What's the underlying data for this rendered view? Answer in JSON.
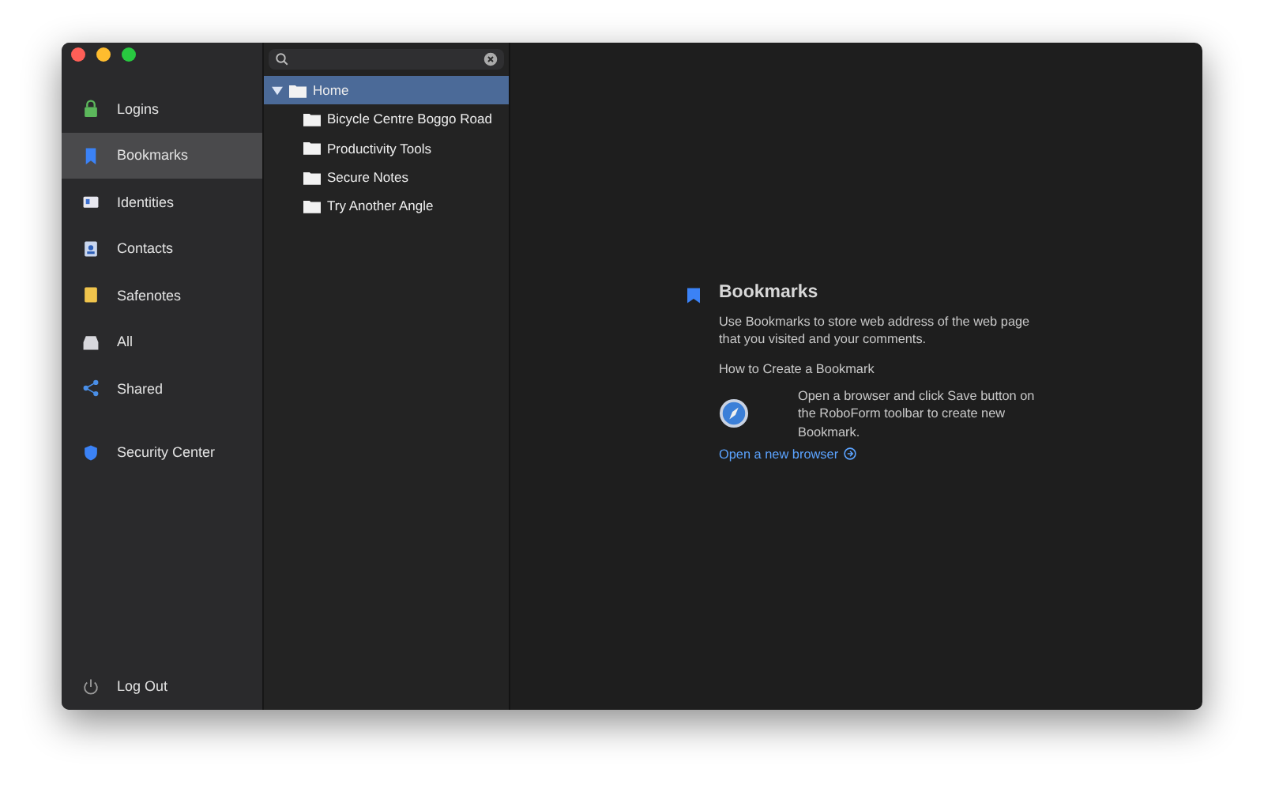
{
  "sidebar": {
    "items": [
      {
        "label": "Logins",
        "kind": "lock",
        "selected": false
      },
      {
        "label": "Bookmarks",
        "kind": "bookmark",
        "selected": true
      },
      {
        "label": "Identities",
        "kind": "id",
        "selected": false
      },
      {
        "label": "Contacts",
        "kind": "contact",
        "selected": false
      },
      {
        "label": "Safenotes",
        "kind": "note",
        "selected": false
      },
      {
        "label": "All",
        "kind": "tray",
        "selected": false
      },
      {
        "label": "Shared",
        "kind": "share",
        "selected": false
      }
    ],
    "secondary_items": [
      {
        "label": "Security Center",
        "kind": "shield",
        "selected": false
      }
    ],
    "log_out": "Log Out"
  },
  "tree": {
    "items": [
      {
        "label": "Home",
        "expanded": true,
        "selected": true,
        "children": [
          {
            "label": "Bicycle Centre Boggo Road",
            "selected": false
          },
          {
            "label": "Productivity Tools",
            "selected": false
          },
          {
            "label": "Secure Notes",
            "selected": false
          },
          {
            "label": "Try Another Angle",
            "selected": false
          }
        ]
      }
    ]
  },
  "detail": {
    "title": "Bookmarks",
    "description": "Use Bookmarks to store web address of the web page that you visited and your comments.",
    "subtitle": "How to Create a Bookmark",
    "step": "Open a browser and click Save button on the RoboForm toolbar to create new Bookmark.",
    "link": "Open a new browser"
  }
}
